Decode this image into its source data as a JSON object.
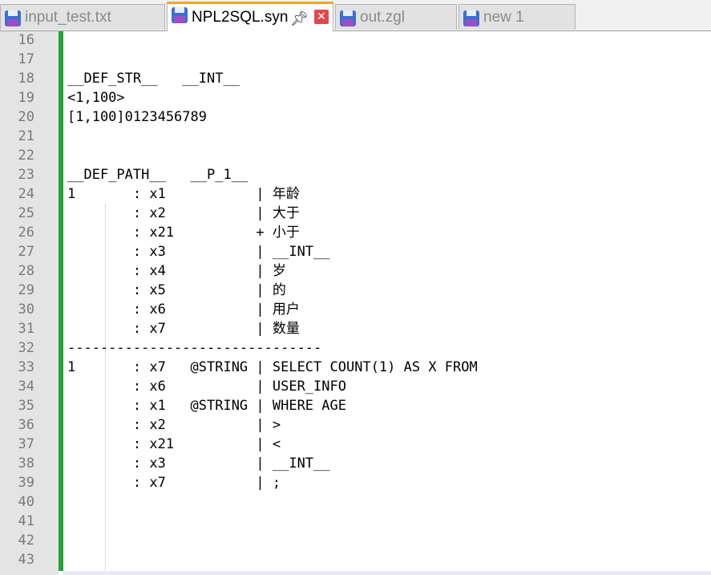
{
  "tabs": [
    {
      "label": "input_test.txt",
      "active": false
    },
    {
      "label": "NPL2SQL.syn",
      "active": true
    },
    {
      "label": "out.zgl",
      "active": false
    },
    {
      "label": "new 1",
      "active": false
    }
  ],
  "icons": {
    "file": "floppy-disk-icon",
    "pin": "pin-icon",
    "close": "close-icon",
    "close_color": "#e0484e",
    "accent": "#f5a422",
    "fold_margin_color": "#1fa535"
  },
  "editor": {
    "lines": [
      {
        "n": "16",
        "text": ""
      },
      {
        "n": "17",
        "text": ""
      },
      {
        "n": "18",
        "text": "__DEF_STR__   __INT__"
      },
      {
        "n": "19",
        "text": "<1,100>"
      },
      {
        "n": "20",
        "text": "[1,100]0123456789"
      },
      {
        "n": "21",
        "text": ""
      },
      {
        "n": "22",
        "text": ""
      },
      {
        "n": "23",
        "text": "__DEF_PATH__   __P_1__"
      },
      {
        "n": "24",
        "text": "1       : x1           | 年龄"
      },
      {
        "n": "25",
        "text": "        : x2           | 大于"
      },
      {
        "n": "26",
        "text": "        : x21          + 小于"
      },
      {
        "n": "27",
        "text": "        : x3           | __INT__"
      },
      {
        "n": "28",
        "text": "        : x4           | 岁"
      },
      {
        "n": "29",
        "text": "        : x5           | 的"
      },
      {
        "n": "30",
        "text": "        : x6           | 用户"
      },
      {
        "n": "31",
        "text": "        : x7           | 数量"
      },
      {
        "n": "32",
        "text": "-------------------------------"
      },
      {
        "n": "33",
        "text": "1       : x7   @STRING | SELECT COUNT(1) AS X FROM"
      },
      {
        "n": "34",
        "text": "        : x6           | USER_INFO"
      },
      {
        "n": "35",
        "text": "        : x1   @STRING | WHERE AGE"
      },
      {
        "n": "36",
        "text": "        : x2           | >"
      },
      {
        "n": "37",
        "text": "        : x21          | <"
      },
      {
        "n": "38",
        "text": "        : x3           | __INT__"
      },
      {
        "n": "39",
        "text": "        : x7           | ;"
      },
      {
        "n": "40",
        "text": ""
      },
      {
        "n": "41",
        "text": ""
      },
      {
        "n": "42",
        "text": ""
      },
      {
        "n": "43",
        "text": ""
      }
    ]
  }
}
